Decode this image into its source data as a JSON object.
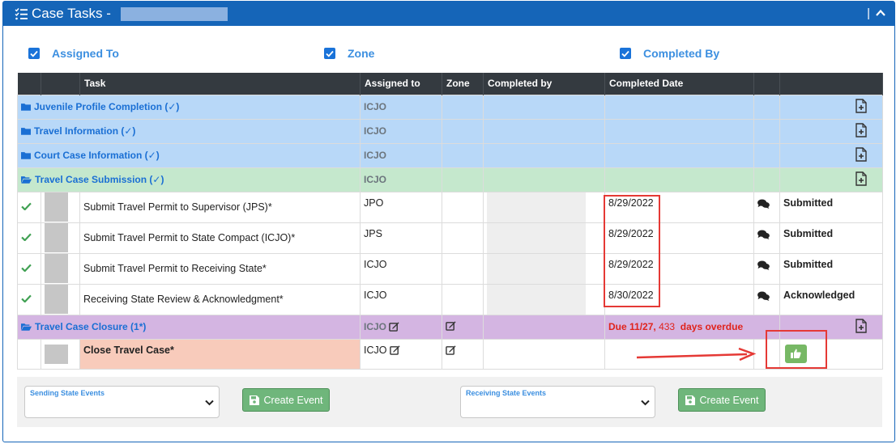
{
  "header": {
    "title": "Case Tasks -",
    "divider": "|"
  },
  "filters": [
    {
      "label": "Assigned To",
      "checked": true
    },
    {
      "label": "Zone",
      "checked": true
    },
    {
      "label": "Completed By",
      "checked": true
    }
  ],
  "columns": [
    "",
    "",
    "Task",
    "Assigned to",
    "Zone",
    "Completed by",
    "Completed Date",
    "",
    ""
  ],
  "groups": {
    "g1": {
      "name": "Juvenile Profile Completion (✓)",
      "assigned": "ICJO"
    },
    "g2": {
      "name": "Travel Information (✓)",
      "assigned": "ICJO"
    },
    "g3": {
      "name": "Court Case Information (✓)",
      "assigned": "ICJO"
    },
    "g4": {
      "name": "Travel Case Submission (✓)",
      "assigned": "ICJO"
    },
    "g5": {
      "name": "Travel Case Closure (1*)",
      "assigned": "ICJO",
      "due_label": "Due",
      "due_date": "11/27,",
      "due_days": "433",
      "due_suffix": "days overdue"
    }
  },
  "tasks": [
    {
      "task": "Submit Travel Permit to Supervisor (JPS)*",
      "assigned": "JPO",
      "date": "8/29/2022",
      "status": "Submitted"
    },
    {
      "task": "Submit Travel Permit to State Compact (ICJO)*",
      "assigned": "JPS",
      "date": "8/29/2022",
      "status": "Submitted"
    },
    {
      "task": "Submit Travel Permit to Receiving State*",
      "assigned": "ICJO",
      "date": "8/29/2022",
      "status": "Submitted"
    },
    {
      "task": "Receiving State Review & Acknowledgment*",
      "assigned": "ICJO",
      "date": "8/30/2022",
      "status": "Acknowledged"
    }
  ],
  "closure_task": {
    "task": "Close Travel Case*",
    "assigned": "ICJO"
  },
  "footer": {
    "sending": {
      "placeholder": "Sending State Events"
    },
    "receiving": {
      "placeholder": "Receiving State Events"
    },
    "create_label": "Create Event"
  },
  "colors": {
    "header": "#1565b8",
    "blue_row": "#b8d8f8",
    "green_row": "#c5e8cd",
    "purple_row": "#d4b5e2",
    "highlight": "#e53935",
    "button": "#6fb67b"
  }
}
